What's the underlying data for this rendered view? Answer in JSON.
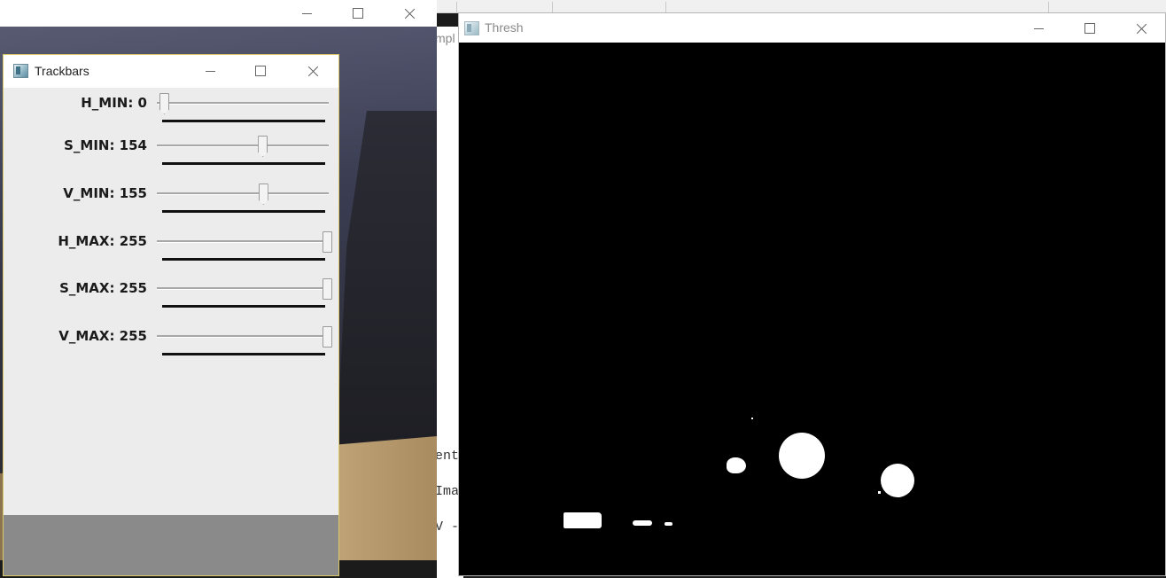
{
  "camera_window": {
    "controls": {
      "minimize": "minimize",
      "maximize": "maximize",
      "close": "close"
    }
  },
  "background_console": {
    "lines": [
      "ent",
      "Ima",
      "V -"
    ],
    "top_text": "mpl"
  },
  "trackbars_window": {
    "title": "Trackbars",
    "sliders": [
      {
        "label": "H_MIN: 0",
        "value": 0,
        "max": 255
      },
      {
        "label": "S_MIN: 154",
        "value": 154,
        "max": 255
      },
      {
        "label": "V_MIN: 155",
        "value": 155,
        "max": 255
      },
      {
        "label": "H_MAX: 255",
        "value": 255,
        "max": 255
      },
      {
        "label": "S_MAX: 255",
        "value": 255,
        "max": 255
      },
      {
        "label": "V_MAX: 255",
        "value": 255,
        "max": 255
      }
    ]
  },
  "thresh_window": {
    "title": "Thresh"
  },
  "colors": {
    "trackbar_border": "#d9c96c",
    "thresh_background": "#000000",
    "blob_color": "#ffffff",
    "footer_gray": "#8a8a8a"
  }
}
